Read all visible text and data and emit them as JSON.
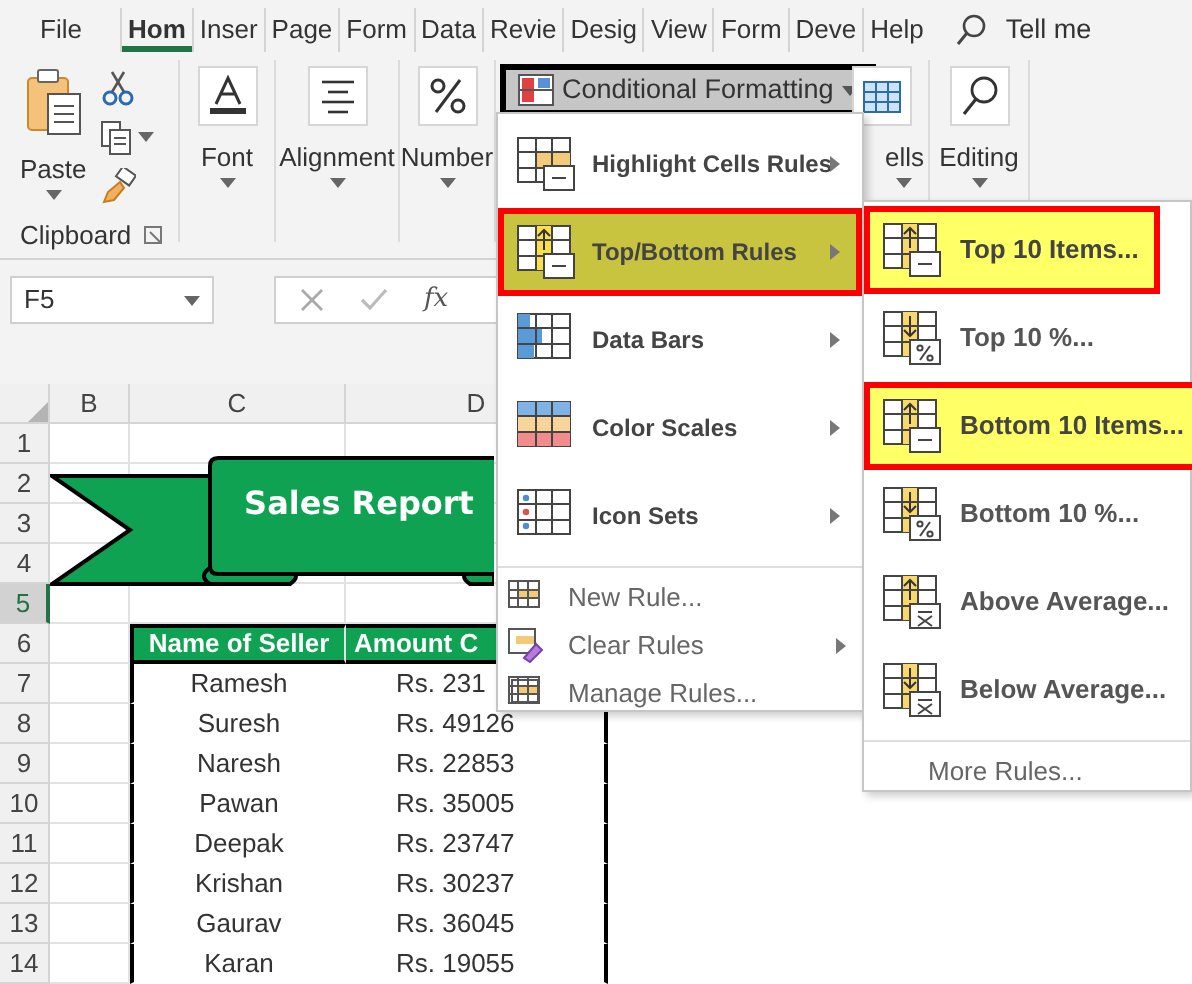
{
  "ribbon_tabs": [
    {
      "label": "File",
      "selected": false
    },
    {
      "label": "Hom",
      "selected": true
    },
    {
      "label": "Inser",
      "selected": false
    },
    {
      "label": "Page",
      "selected": false
    },
    {
      "label": "Form",
      "selected": false
    },
    {
      "label": "Data",
      "selected": false
    },
    {
      "label": "Revie",
      "selected": false
    },
    {
      "label": "Desig",
      "selected": false
    },
    {
      "label": "View",
      "selected": false
    },
    {
      "label": "Form",
      "selected": false
    },
    {
      "label": "Deve",
      "selected": false
    },
    {
      "label": "Help",
      "selected": false
    }
  ],
  "tell_me": "Tell me",
  "ribbon": {
    "paste": "Paste",
    "clipboard": "Clipboard",
    "font": "Font",
    "alignment": "Alignment",
    "number": "Number",
    "conditional_formatting": "Conditional Formatting",
    "cells": "ells",
    "editing": "Editing"
  },
  "formula_bar": {
    "name_box": "F5",
    "function_label": "fx"
  },
  "sheet": {
    "columns": [
      "B",
      "C",
      "D"
    ],
    "rows": [
      {
        "label": "1",
        "selected": false
      },
      {
        "label": "2",
        "selected": false
      },
      {
        "label": "3",
        "selected": false
      },
      {
        "label": "4",
        "selected": false
      },
      {
        "label": "5",
        "selected": true
      },
      {
        "label": "6",
        "selected": false
      },
      {
        "label": "7",
        "selected": false
      },
      {
        "label": "8",
        "selected": false
      },
      {
        "label": "9",
        "selected": false
      },
      {
        "label": "10",
        "selected": false
      },
      {
        "label": "11",
        "selected": false
      },
      {
        "label": "12",
        "selected": false
      },
      {
        "label": "13",
        "selected": false
      },
      {
        "label": "14",
        "selected": false
      }
    ]
  },
  "banner_title": "Sales Report",
  "table": {
    "columns": [
      "Name of Seller",
      "Amount C"
    ],
    "rows": [
      [
        "Ramesh",
        "Rs. 231"
      ],
      [
        "Suresh",
        "Rs. 49126"
      ],
      [
        "Naresh",
        "Rs. 22853"
      ],
      [
        "Pawan",
        "Rs. 35005"
      ],
      [
        "Deepak",
        "Rs. 23747"
      ],
      [
        "Krishan",
        "Rs. 30237"
      ],
      [
        "Gaurav",
        "Rs. 36045"
      ],
      [
        "Karan",
        "Rs. 19055"
      ]
    ]
  },
  "menu": {
    "items": [
      {
        "kind": "large",
        "label": "Highlight Cells Rules",
        "selected": false,
        "has_submenu": true
      },
      {
        "kind": "large",
        "label": "Top/Bottom Rules",
        "selected": true,
        "has_submenu": true
      },
      {
        "kind": "large",
        "label": "Data Bars",
        "selected": false,
        "has_submenu": true
      },
      {
        "kind": "large",
        "label": "Color Scales",
        "selected": false,
        "has_submenu": true
      },
      {
        "kind": "large",
        "label": "Icon Sets",
        "selected": false,
        "has_submenu": true
      },
      {
        "kind": "small",
        "label": "New Rule...",
        "selected": false,
        "has_submenu": false
      },
      {
        "kind": "small",
        "label": "Clear Rules",
        "selected": false,
        "has_submenu": true
      },
      {
        "kind": "small",
        "label": "Manage Rules...",
        "selected": false,
        "has_submenu": false
      }
    ]
  },
  "submenu": {
    "items": [
      {
        "label": "Top 10 Items...",
        "selected": true
      },
      {
        "label": "Top 10 %...",
        "selected": false
      },
      {
        "label": "Bottom 10 Items...",
        "selected": true
      },
      {
        "label": "Bottom 10 %...",
        "selected": false
      },
      {
        "label": "Above Average...",
        "selected": false
      },
      {
        "label": "Below Average...",
        "selected": false
      }
    ],
    "more": "More Rules..."
  }
}
